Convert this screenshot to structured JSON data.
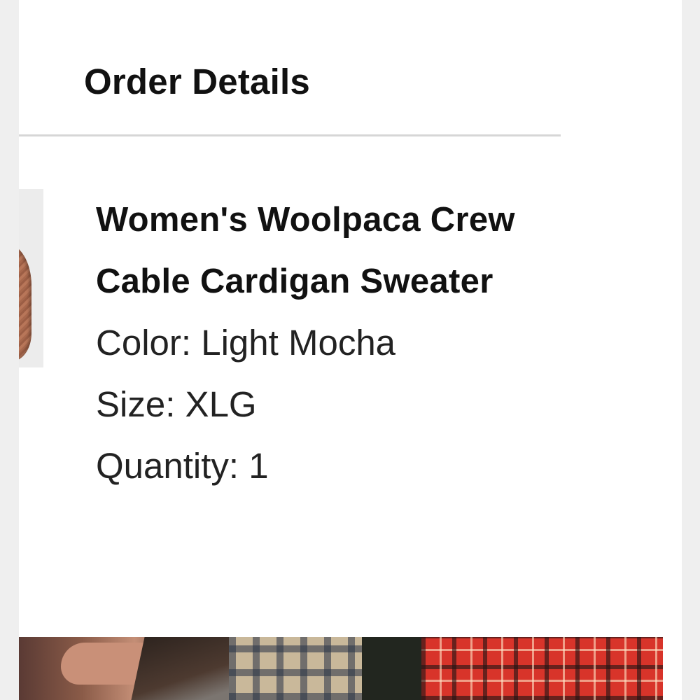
{
  "order_details": {
    "title": "Order Details"
  },
  "item": {
    "name": "Women's Woolpaca Crew Cable Cardigan Sweater",
    "color_line": "Color: Light Mocha",
    "size_line": "Size: XLG",
    "quantity_line": "Quantity: 1"
  },
  "colors": {
    "page_background": "#efefef",
    "card_background": "#ffffff",
    "divider": "#d6d6d6",
    "heading_text": "#111111",
    "body_text": "#222222"
  }
}
